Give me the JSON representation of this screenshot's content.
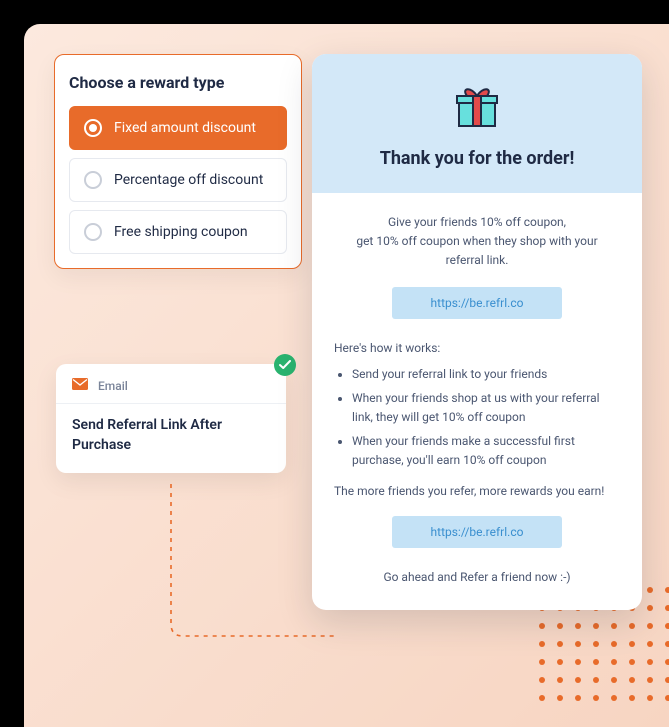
{
  "reward_panel": {
    "title": "Choose a reward type",
    "options": [
      {
        "label": "Fixed amount discount",
        "selected": true
      },
      {
        "label": "Percentage off discount",
        "selected": false
      },
      {
        "label": "Free shipping coupon",
        "selected": false
      }
    ]
  },
  "email_card": {
    "tag": "Email",
    "title": "Send Referral Link After Purchase",
    "status": "success"
  },
  "preview": {
    "heading": "Thank you for the order!",
    "intro": "Give your friends 10% off coupon,\nget 10% off coupon when they shop with your\nreferral link.",
    "referral_link": "https://be.refrl.co",
    "how_title": "Here's how it works:",
    "how_items": [
      "Send your referral link to your friends",
      "When your friends shop at us with your referral link, they will get 10% off coupon",
      "When your friends make a successful first purchase, you'll earn 10% off coupon"
    ],
    "outro": "The more friends you refer, more rewards you earn!",
    "cta": "Go ahead and Refer a friend now :-)"
  },
  "colors": {
    "accent": "#e86b2a",
    "success": "#2ab36f",
    "link_chip_bg": "#c4e2f6",
    "preview_top_bg": "#d3e8f8"
  }
}
